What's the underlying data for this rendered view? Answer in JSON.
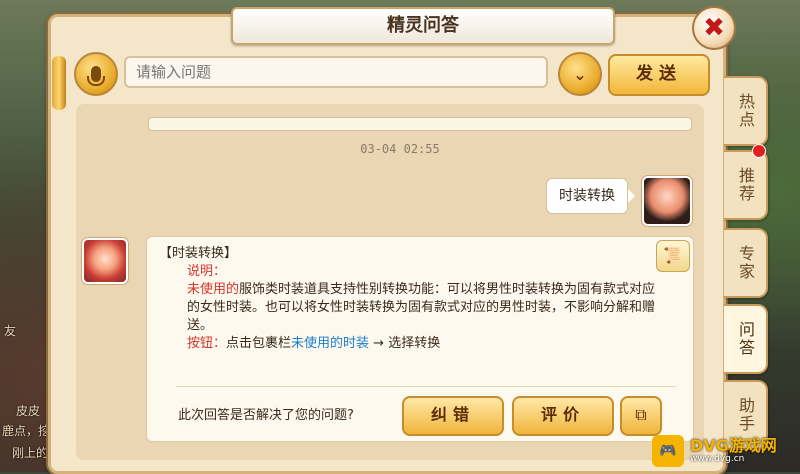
{
  "dialog": {
    "title": "精灵问答",
    "close_symbol": "✖"
  },
  "input_row": {
    "placeholder": "请输入问题",
    "dropdown_symbol": "⌄",
    "send_label": "发送"
  },
  "chat": {
    "timestamp": "03-04 02:55",
    "user_message": "时装转换",
    "bot_message": {
      "header": "【时装转换】",
      "desc_label": "说明：",
      "desc_highlight": "未使用的",
      "desc_rest": "服饰类时装道具支持性别转换功能：可以将男性时装转换为固有款式对应的女性时装。也可以将女性时装转换为固有款式对应的男性时装，不影响分解和赠送。",
      "button_label": "按钮：",
      "button_prefix": "点击包裹栏",
      "button_link": "未使用的时装",
      "button_suffix": " → 选择转换"
    },
    "feedback_question": "此次回答是否解决了您的问题?",
    "correct_label": "纠错",
    "rate_label": "评价"
  },
  "side_tabs": [
    {
      "label": "热点"
    },
    {
      "label": "推荐"
    },
    {
      "label": "专家"
    },
    {
      "label": "问答"
    },
    {
      "label": "助手"
    }
  ],
  "background": {
    "text_left_1": "友",
    "text_left_2": "皮皮",
    "text_left_3": "鹿点，挖",
    "text_left_4": "刚上的"
  },
  "watermark": {
    "brand": "DVG游戏网",
    "url": "www.dvg.cn"
  },
  "colors": {
    "accent": "#f0b43c",
    "highlight_red": "#d8342a",
    "link_blue": "#1a7fcf"
  }
}
